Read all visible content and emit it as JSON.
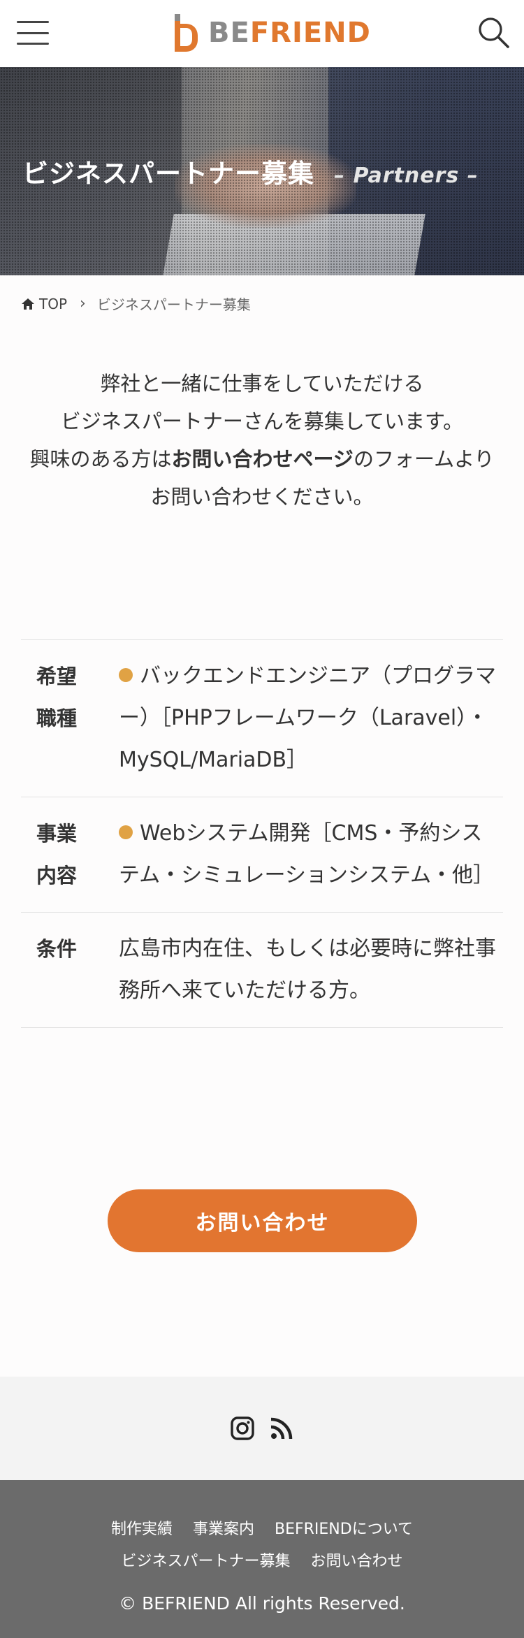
{
  "header": {
    "logo_be": "BE",
    "logo_friend": "FRIEND"
  },
  "hero": {
    "title": "ビジネスパートナー募集",
    "subtitle": "– Partners –"
  },
  "breadcrumb": {
    "home": "TOP",
    "current": "ビジネスパートナー募集"
  },
  "intro": {
    "line1": "弊社と一緒に仕事をしていただける",
    "line2": "ビジネスパートナーさんを募集しています。",
    "line3_pre": "興味のある方は",
    "line3_link": "お問い合わせページ",
    "line3_post": "のフォームより",
    "line4": "お問い合わせください。"
  },
  "table": {
    "rows": [
      {
        "heading_1": "希望",
        "heading_2": "職種",
        "value": "バックエンドエンジニア（プログラマー）［PHPフレームワーク（Laravel）・MySQL/MariaDB］"
      },
      {
        "heading_1": "事業",
        "heading_2": "内容",
        "value": "Webシステム開発［CMS・予約システム・シミュレーションシステム・他］"
      },
      {
        "heading_1": "条件",
        "heading_2": "",
        "value": "広島市内在住、もしくは必要時に弊社事務所へ来ていただける方。"
      }
    ],
    "bullet_color": "#e0a244"
  },
  "cta": {
    "label": "お問い合わせ",
    "color": "#e27530"
  },
  "social": {
    "icons": [
      "instagram-icon",
      "rss-icon"
    ]
  },
  "footer": {
    "nav": [
      "制作実績",
      "事業案内",
      "BEFRIENDについて",
      "ビジネスパートナー募集",
      "お問い合わせ"
    ],
    "copyright": "© BEFRIEND All rights Reserved."
  },
  "colors": {
    "accent": "#e27530",
    "footer_bg": "#6b6b6b",
    "social_bg": "#f3f3f3"
  }
}
